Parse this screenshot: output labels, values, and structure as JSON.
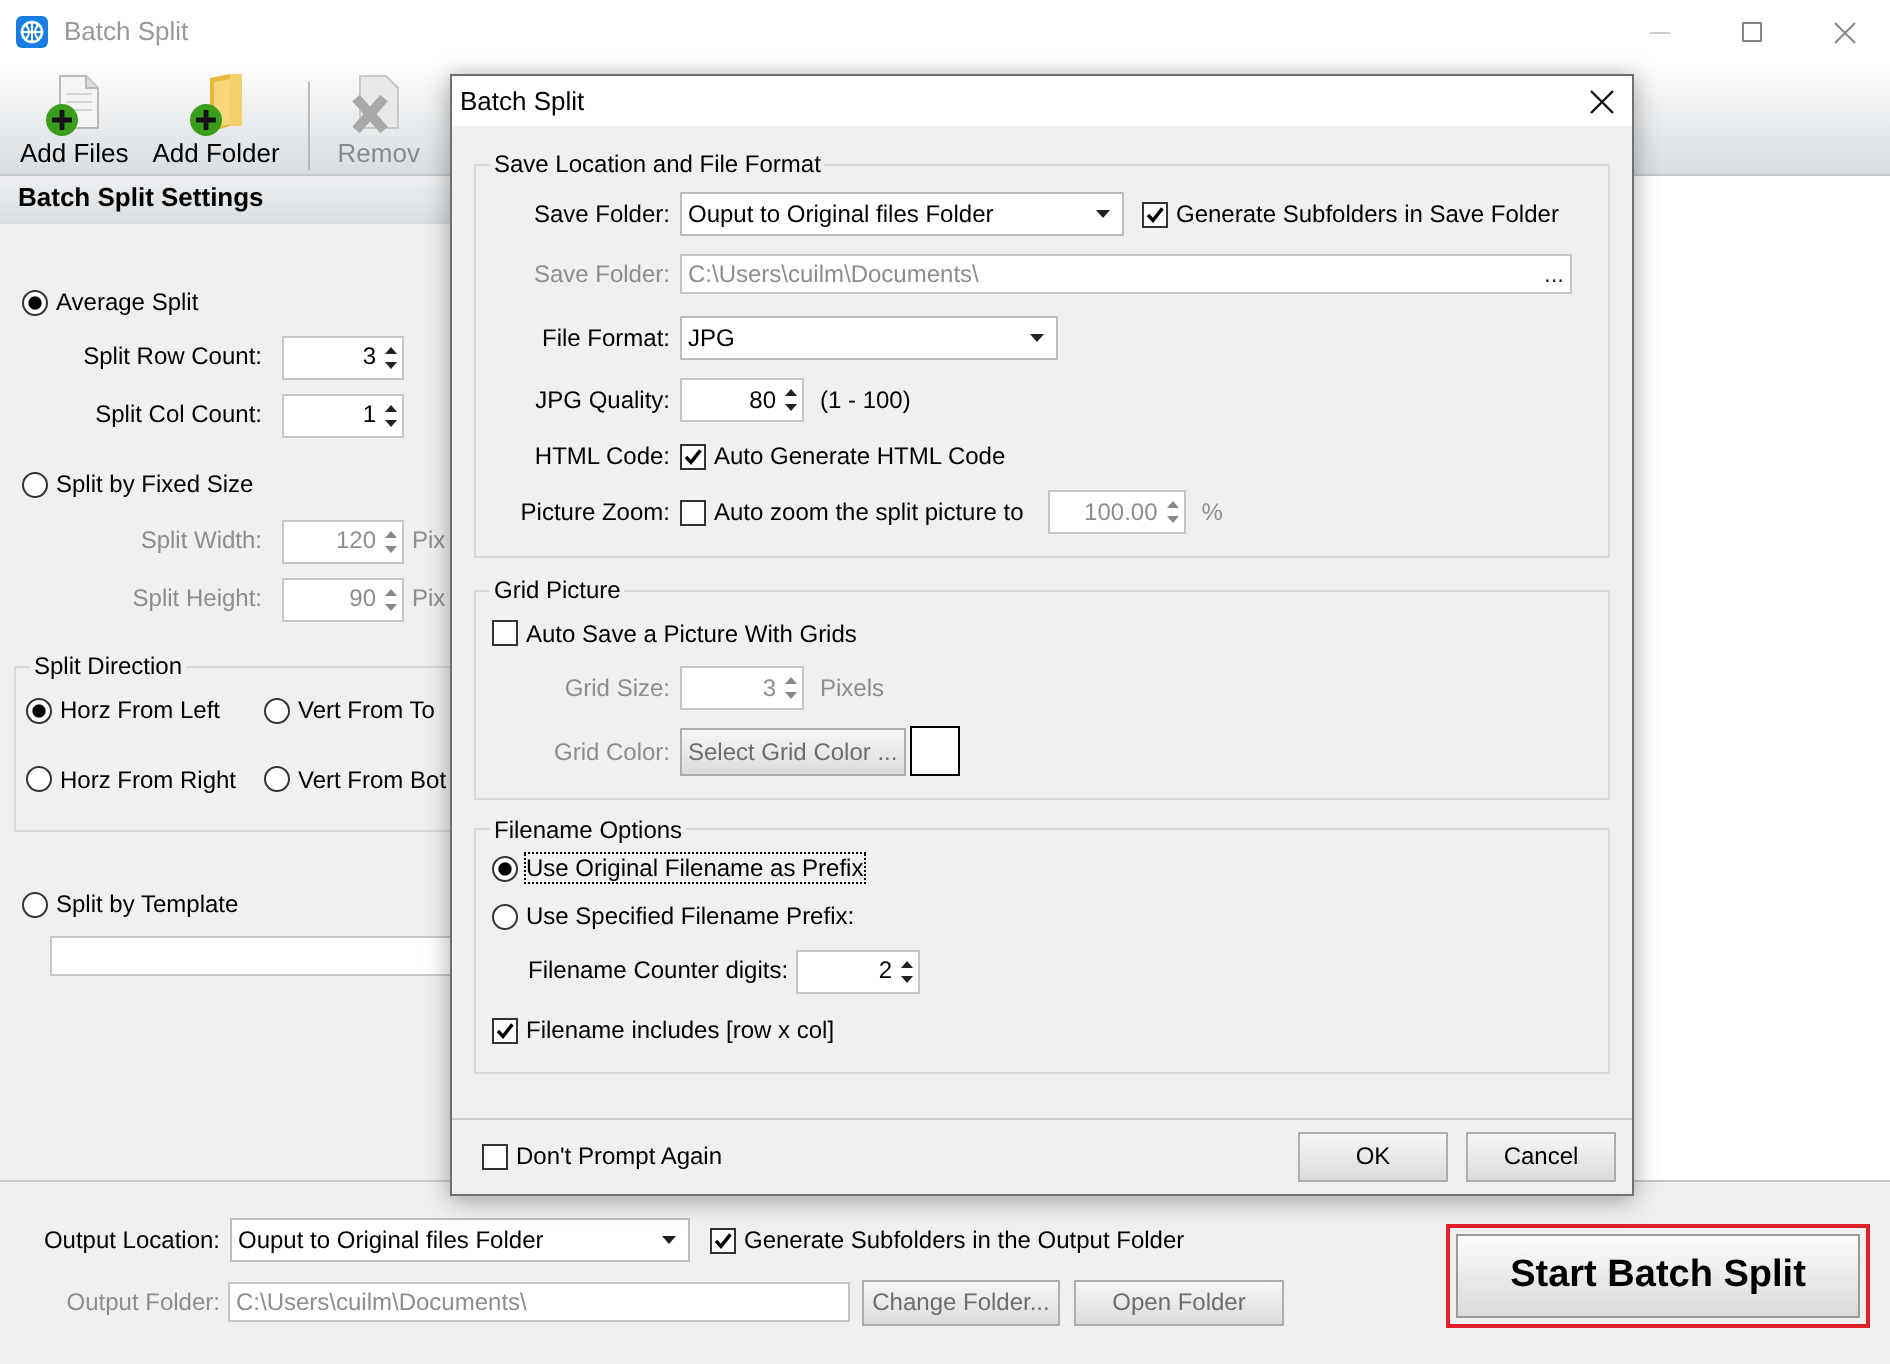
{
  "window": {
    "title": "Batch Split"
  },
  "toolbar": [
    {
      "kind": "add-files",
      "label": "Add Files",
      "disabled": false
    },
    {
      "kind": "add-folder",
      "label": "Add Folder",
      "disabled": false
    },
    {
      "kind": "remove",
      "label": "Remov",
      "disabled": true
    }
  ],
  "settings": {
    "title": "Batch Split Settings",
    "average_split": {
      "label": "Average Split",
      "selected": true,
      "fields": [
        {
          "label": "Split Row Count:",
          "value": "3",
          "disabled": false
        },
        {
          "label": "Split Col Count:",
          "value": "1",
          "disabled": false
        }
      ]
    },
    "fixed_size": {
      "label": "Split by Fixed Size",
      "selected": false,
      "fields": [
        {
          "label": "Split Width:",
          "value": "120",
          "unit": "Pix",
          "disabled": true
        },
        {
          "label": "Split Height:",
          "value": "90",
          "unit": "Pix",
          "disabled": true
        }
      ]
    },
    "direction": {
      "title": "Split Direction",
      "options": [
        {
          "label": "Horz From Left",
          "selected": true
        },
        {
          "label": "Vert From To",
          "selected": false
        },
        {
          "label": "Horz From Right",
          "selected": false
        },
        {
          "label": "Vert From Bot",
          "selected": false
        }
      ]
    },
    "template": {
      "label": "Split by Template",
      "selected": false
    }
  },
  "dialog": {
    "title": "Batch Split",
    "save_group": {
      "title": "Save Location and File Format",
      "save_folder": {
        "label": "Save Folder:",
        "value": "Ouput to Original files Folder"
      },
      "generate_subfolders": {
        "label": "Generate Subfolders in Save Folder",
        "checked": true
      },
      "save_path": {
        "label": "Save Folder:",
        "value": "C:\\Users\\cuilm\\Documents\\",
        "browse": "...",
        "disabled": true
      },
      "file_format": {
        "label": "File Format:",
        "value": "JPG"
      },
      "jpg_quality": {
        "label": "JPG Quality:",
        "value": "80",
        "hint": "(1 - 100)"
      },
      "html_code": {
        "label": "HTML Code:",
        "option": "Auto Generate HTML Code",
        "checked": true
      },
      "picture_zoom": {
        "label": "Picture Zoom:",
        "option": "Auto zoom the split picture to",
        "checked": false,
        "value": "100.00",
        "unit": "%"
      }
    },
    "grid_group": {
      "title": "Grid Picture",
      "auto_save": {
        "label": "Auto Save a Picture With Grids",
        "checked": false
      },
      "grid_size": {
        "label": "Grid Size:",
        "value": "3",
        "unit": "Pixels",
        "disabled": true
      },
      "grid_color": {
        "label": "Grid Color:",
        "button": "Select Grid Color ...",
        "disabled": true
      }
    },
    "filename_group": {
      "title": "Filename Options",
      "prefix_options": [
        {
          "label": "Use Original Filename as Prefix",
          "selected": true
        },
        {
          "label": "Use Specified Filename Prefix:",
          "selected": false
        }
      ],
      "counter": {
        "label": "Filename Counter digits:",
        "value": "2"
      },
      "include_row_col": {
        "label": "Filename includes [row x col]",
        "checked": true
      }
    },
    "dont_prompt": {
      "label": "Don't Prompt Again",
      "checked": false
    },
    "buttons": [
      "OK",
      "Cancel"
    ]
  },
  "output": {
    "location": {
      "label": "Output Location:",
      "value": "Ouput to Original files Folder"
    },
    "generate_subfolders": {
      "label": "Generate Subfolders in the Output Folder",
      "checked": true
    },
    "folder": {
      "label": "Output Folder:",
      "value": "C:\\Users\\cuilm\\Documents\\",
      "disabled": true
    },
    "buttons": [
      "Change Folder...",
      "Open Folder"
    ]
  },
  "start_button": {
    "label": "Start Batch Split",
    "highlighted": true
  }
}
